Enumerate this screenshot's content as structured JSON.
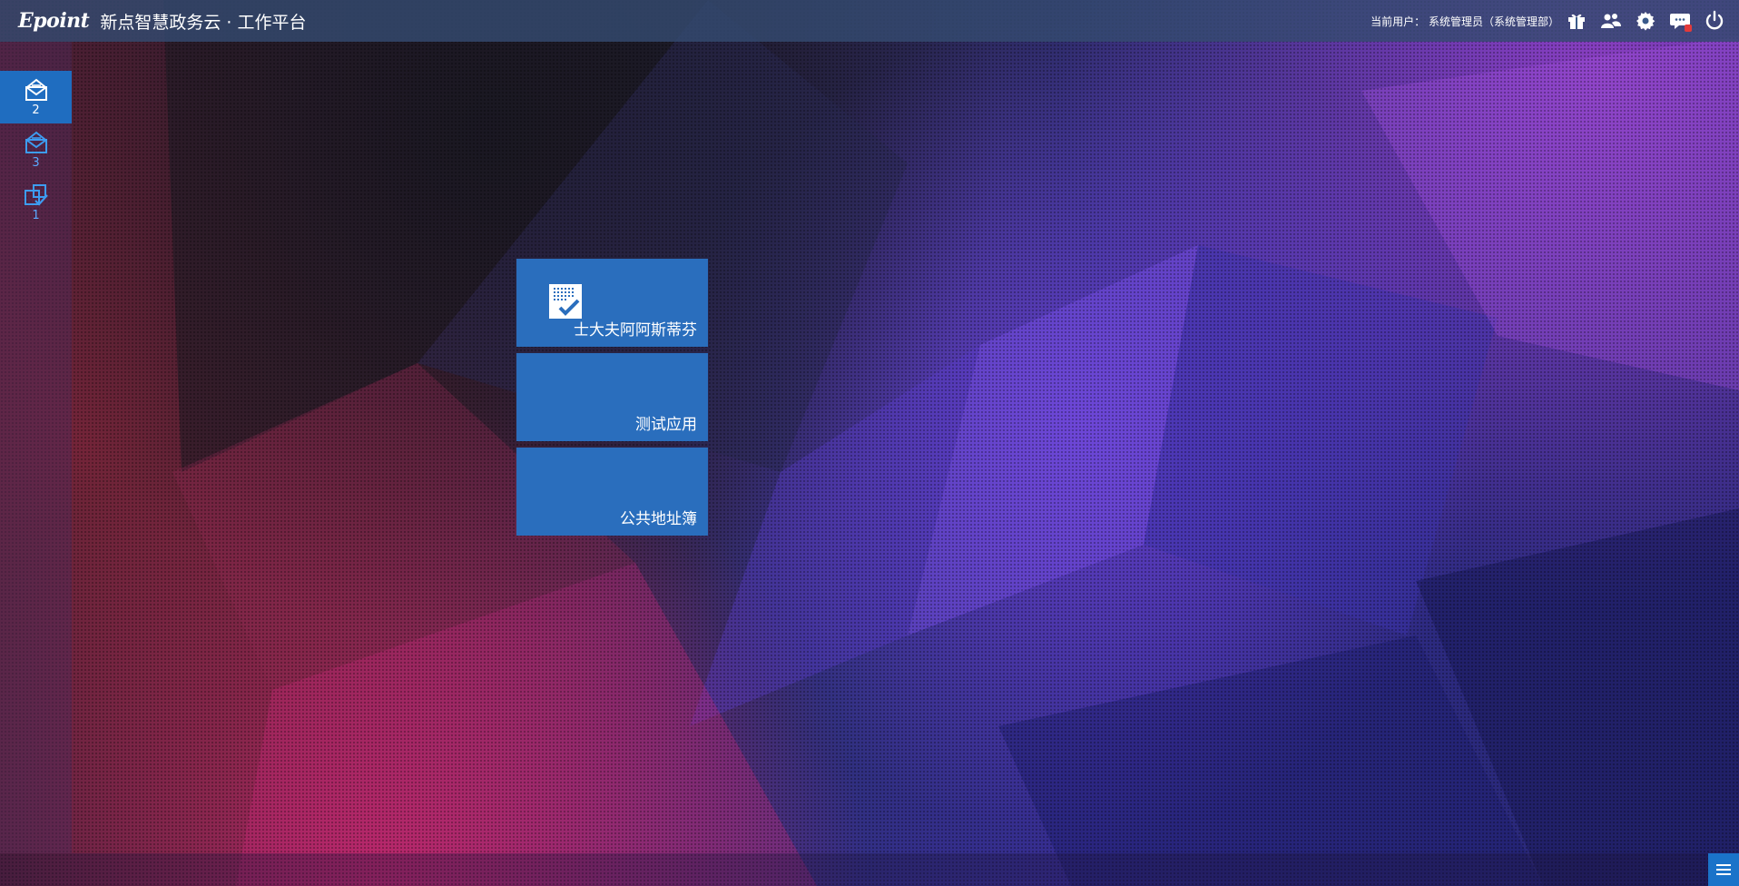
{
  "header": {
    "logo_text": "Epoint",
    "title": "新点智慧政务云 · 工作平台",
    "current_user": "当前用户： 系统管理员（系统管理部）"
  },
  "header_icons": [
    "gift-icon",
    "users-icon",
    "settings-gear-icon",
    "message-icon",
    "power-icon"
  ],
  "sidebar": {
    "items": [
      {
        "icon": "inbox-mail-icon",
        "count": "2",
        "active": true
      },
      {
        "icon": "mail-envelope-icon",
        "count": "3",
        "active": false
      },
      {
        "icon": "task-check-icon",
        "count": "1",
        "active": false
      }
    ]
  },
  "tiles": [
    {
      "label": "士大夫阿阿斯蒂芬",
      "icon": "calendar-check-icon"
    },
    {
      "label": "测试应用"
    },
    {
      "label": "公共地址簿"
    }
  ],
  "colors": {
    "tile": "#2a6ebd",
    "sidebar_active": "#1f6dc0",
    "accent_blue": "#1a73c9",
    "notification": "#e23a3a"
  }
}
